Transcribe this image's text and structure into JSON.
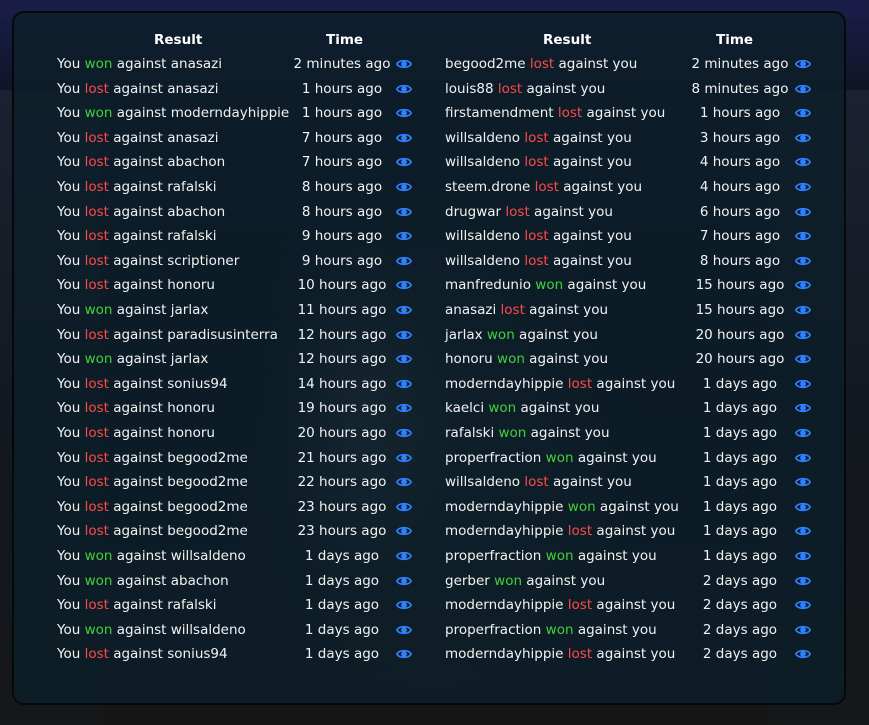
{
  "colors": {
    "won": "#41d13b",
    "lost": "#ff4a4a",
    "eye_icon": "#2f80ff",
    "panel_bg": "rgba(12,31,42,0.82)"
  },
  "icons": {
    "view": "eye-icon"
  },
  "left": {
    "header_result": "Result",
    "header_time": "Time",
    "rows": [
      {
        "pre": "You ",
        "outcome": "won",
        "post": " against anasazi",
        "time": "2 minutes ago"
      },
      {
        "pre": "You ",
        "outcome": "lost",
        "post": " against anasazi",
        "time": "1 hours ago"
      },
      {
        "pre": "You ",
        "outcome": "won",
        "post": " against moderndayhippie",
        "time": "1 hours ago"
      },
      {
        "pre": "You ",
        "outcome": "lost",
        "post": " against anasazi",
        "time": "7 hours ago"
      },
      {
        "pre": "You ",
        "outcome": "lost",
        "post": " against abachon",
        "time": "7 hours ago"
      },
      {
        "pre": "You ",
        "outcome": "lost",
        "post": " against rafalski",
        "time": "8 hours ago"
      },
      {
        "pre": "You ",
        "outcome": "lost",
        "post": " against abachon",
        "time": "8 hours ago"
      },
      {
        "pre": "You ",
        "outcome": "lost",
        "post": " against rafalski",
        "time": "9 hours ago"
      },
      {
        "pre": "You ",
        "outcome": "lost",
        "post": " against scriptioner",
        "time": "9 hours ago"
      },
      {
        "pre": "You ",
        "outcome": "lost",
        "post": " against honoru",
        "time": "10 hours ago"
      },
      {
        "pre": "You ",
        "outcome": "won",
        "post": " against jarlax",
        "time": "11 hours ago"
      },
      {
        "pre": "You ",
        "outcome": "lost",
        "post": " against paradisusinterra",
        "time": "12 hours ago"
      },
      {
        "pre": "You ",
        "outcome": "won",
        "post": " against jarlax",
        "time": "12 hours ago"
      },
      {
        "pre": "You ",
        "outcome": "lost",
        "post": " against sonius94",
        "time": "14 hours ago"
      },
      {
        "pre": "You ",
        "outcome": "lost",
        "post": " against honoru",
        "time": "19 hours ago"
      },
      {
        "pre": "You ",
        "outcome": "lost",
        "post": " against honoru",
        "time": "20 hours ago"
      },
      {
        "pre": "You ",
        "outcome": "lost",
        "post": " against begood2me",
        "time": "21 hours ago"
      },
      {
        "pre": "You ",
        "outcome": "lost",
        "post": " against begood2me",
        "time": "22 hours ago"
      },
      {
        "pre": "You ",
        "outcome": "lost",
        "post": " against begood2me",
        "time": "23 hours ago"
      },
      {
        "pre": "You ",
        "outcome": "lost",
        "post": " against begood2me",
        "time": "23 hours ago"
      },
      {
        "pre": "You ",
        "outcome": "won",
        "post": " against willsaldeno",
        "time": "1 days ago"
      },
      {
        "pre": "You ",
        "outcome": "won",
        "post": " against abachon",
        "time": "1 days ago"
      },
      {
        "pre": "You ",
        "outcome": "lost",
        "post": " against rafalski",
        "time": "1 days ago"
      },
      {
        "pre": "You ",
        "outcome": "won",
        "post": " against willsaldeno",
        "time": "1 days ago"
      },
      {
        "pre": "You ",
        "outcome": "lost",
        "post": " against sonius94",
        "time": "1 days ago"
      }
    ]
  },
  "right": {
    "header_result": "Result",
    "header_time": "Time",
    "rows": [
      {
        "pre": "begood2me ",
        "outcome": "lost",
        "post": " against you",
        "time": "2 minutes ago"
      },
      {
        "pre": "louis88 ",
        "outcome": "lost",
        "post": " against you",
        "time": "8 minutes ago"
      },
      {
        "pre": "firstamendment ",
        "outcome": "lost",
        "post": " against you",
        "time": "1 hours ago"
      },
      {
        "pre": "willsaldeno ",
        "outcome": "lost",
        "post": " against you",
        "time": "3 hours ago"
      },
      {
        "pre": "willsaldeno ",
        "outcome": "lost",
        "post": " against you",
        "time": "4 hours ago"
      },
      {
        "pre": "steem.drone ",
        "outcome": "lost",
        "post": " against you",
        "time": "4 hours ago"
      },
      {
        "pre": "drugwar ",
        "outcome": "lost",
        "post": " against you",
        "time": "6 hours ago"
      },
      {
        "pre": "willsaldeno ",
        "outcome": "lost",
        "post": " against you",
        "time": "7 hours ago"
      },
      {
        "pre": "willsaldeno ",
        "outcome": "lost",
        "post": " against you",
        "time": "8 hours ago"
      },
      {
        "pre": "manfredunio ",
        "outcome": "won",
        "post": " against you",
        "time": "15 hours ago"
      },
      {
        "pre": "anasazi ",
        "outcome": "lost",
        "post": " against you",
        "time": "15 hours ago"
      },
      {
        "pre": "jarlax ",
        "outcome": "won",
        "post": " against you",
        "time": "20 hours ago"
      },
      {
        "pre": "honoru ",
        "outcome": "won",
        "post": " against you",
        "time": "20 hours ago"
      },
      {
        "pre": "moderndayhippie ",
        "outcome": "lost",
        "post": " against you",
        "time": "1 days ago"
      },
      {
        "pre": "kaelci ",
        "outcome": "won",
        "post": " against you",
        "time": "1 days ago"
      },
      {
        "pre": "rafalski ",
        "outcome": "won",
        "post": " against you",
        "time": "1 days ago"
      },
      {
        "pre": "properfraction ",
        "outcome": "won",
        "post": " against you",
        "time": "1 days ago"
      },
      {
        "pre": "willsaldeno ",
        "outcome": "lost",
        "post": " against you",
        "time": "1 days ago"
      },
      {
        "pre": "moderndayhippie ",
        "outcome": "won",
        "post": " against you",
        "time": "1 days ago"
      },
      {
        "pre": "moderndayhippie ",
        "outcome": "lost",
        "post": " against you",
        "time": "1 days ago"
      },
      {
        "pre": "properfraction ",
        "outcome": "won",
        "post": " against you",
        "time": "1 days ago"
      },
      {
        "pre": "gerber ",
        "outcome": "won",
        "post": " against you",
        "time": "2 days ago"
      },
      {
        "pre": "moderndayhippie ",
        "outcome": "lost",
        "post": " against you",
        "time": "2 days ago"
      },
      {
        "pre": "properfraction ",
        "outcome": "won",
        "post": " against you",
        "time": "2 days ago"
      },
      {
        "pre": "moderndayhippie ",
        "outcome": "lost",
        "post": " against you",
        "time": "2 days ago"
      }
    ]
  }
}
